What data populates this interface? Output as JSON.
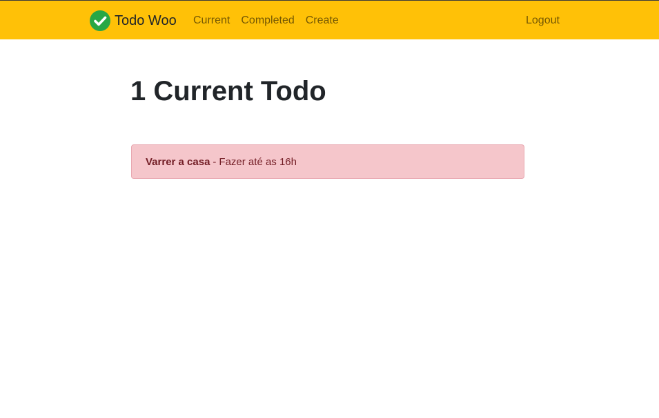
{
  "navbar": {
    "brand": "Todo Woo",
    "links": [
      {
        "label": "Current"
      },
      {
        "label": "Completed"
      },
      {
        "label": "Create"
      }
    ],
    "logout": "Logout"
  },
  "main": {
    "title": "1 Current Todo",
    "todos": [
      {
        "title": "Varrer a casa",
        "separator": "-",
        "memo": "Fazer até as 16h"
      }
    ]
  },
  "colors": {
    "navbar_bg": "#ffc107",
    "brand_icon": "#28a745",
    "todo_bg": "#f5c6cb",
    "todo_text": "#721c24"
  }
}
